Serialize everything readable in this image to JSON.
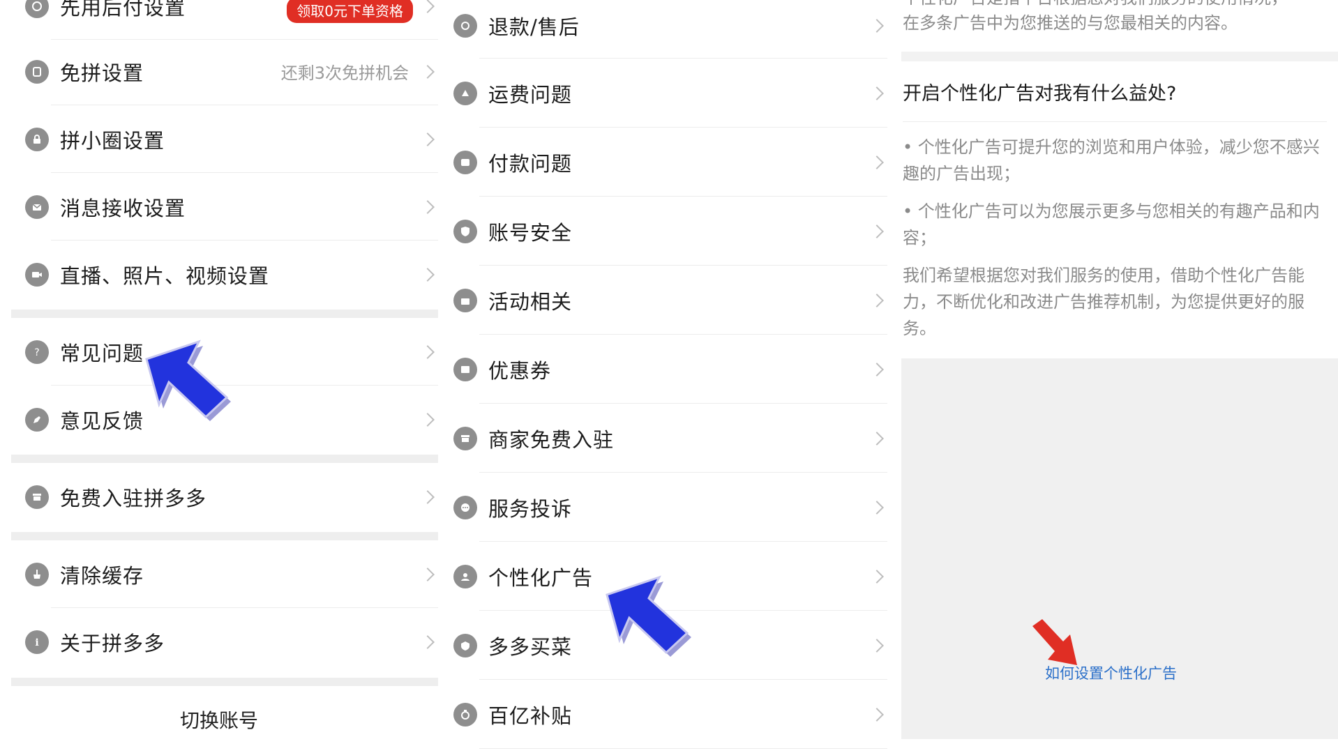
{
  "panel_left": {
    "partial_top_item": {
      "label": "先用后付设置",
      "badge": "领取0元下单资格"
    },
    "items": [
      {
        "label": "免拼设置",
        "value": "还剩3次免拼机会",
        "icon": "copy-icon"
      },
      {
        "label": "拼小圈设置",
        "value": "",
        "icon": "lock-icon"
      },
      {
        "label": "消息接收设置",
        "value": "",
        "icon": "mail-icon"
      },
      {
        "label": "直播、照片、视频设置",
        "value": "",
        "icon": "video-icon"
      },
      {
        "label": "常见问题",
        "value": "",
        "icon": "question-icon"
      },
      {
        "label": "意见反馈",
        "value": "",
        "icon": "pencil-icon"
      },
      {
        "label": "免费入驻拼多多",
        "value": "",
        "icon": "store-icon"
      },
      {
        "label": "清除缓存",
        "value": "",
        "icon": "broom-icon"
      },
      {
        "label": "关于拼多多",
        "value": "",
        "icon": "info-icon"
      }
    ],
    "switch_account": "切换账号"
  },
  "panel_middle": {
    "items": [
      {
        "label": "退款/售后",
        "icon": "refund-icon"
      },
      {
        "label": "运费问题",
        "icon": "truck-icon"
      },
      {
        "label": "付款问题",
        "icon": "wallet-icon"
      },
      {
        "label": "账号安全",
        "icon": "shield-icon"
      },
      {
        "label": "活动相关",
        "icon": "gift-icon"
      },
      {
        "label": "优惠券",
        "icon": "coupon-icon"
      },
      {
        "label": "商家免费入驻",
        "icon": "store-icon"
      },
      {
        "label": "服务投诉",
        "icon": "chat-icon"
      },
      {
        "label": "个性化广告",
        "icon": "person-icon"
      },
      {
        "label": "多多买菜",
        "icon": "leaf-icon"
      },
      {
        "label": "百亿补贴",
        "icon": "money-icon"
      }
    ]
  },
  "panel_right": {
    "top_text_partial": "个性化广告是指平台根据您对我们服务的使用情况，",
    "top_text": "在多条广告中为您推送的与您最相关的内容。",
    "heading": "开启个性化广告对我有什么益处?",
    "bullet_1": "• 个性化广告可提升您的浏览和用户体验，减少您不感兴趣的广告出现；",
    "bullet_2": "• 个性化广告可以为您展示更多与您相关的有趣产品和内容；",
    "paragraph": "我们希望根据您对我们服务的使用，借助个性化广告能力，不断优化和改进广告推荐机制，为您提供更好的服务。",
    "link": "如何设置个性化广告"
  },
  "colors": {
    "accent_red": "#e02e24",
    "link_blue": "#2a6fc9",
    "icon_gray": "#8e8e8e",
    "pointer_blue": "#2233dd"
  }
}
